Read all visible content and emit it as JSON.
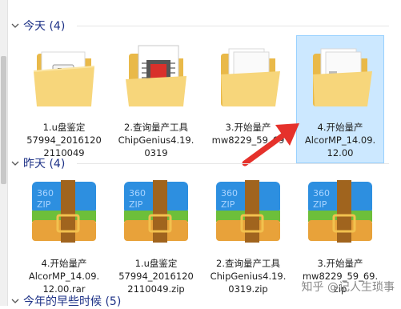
{
  "groups": [
    {
      "title": "今天 (4)"
    },
    {
      "title": "昨天 (4)"
    },
    {
      "title": "今年的早些时候 (5)"
    }
  ],
  "today": [
    {
      "lines": [
        "1.u盘鉴定",
        "57994_2016120",
        "2110049"
      ],
      "icon": "usb-folder-icon"
    },
    {
      "lines": [
        "2.查询量产工具",
        "ChipGenius4.19.",
        "0319"
      ],
      "icon": "chip-folder-icon"
    },
    {
      "lines": [
        "3.开始量产",
        "mw8229_59_69"
      ],
      "icon": "document-folder-icon"
    },
    {
      "lines": [
        "4.开始量产",
        "AlcorMP_14.09.",
        "12.00"
      ],
      "icon": "document-folder-icon",
      "selected": true
    }
  ],
  "yesterday": [
    {
      "lines": [
        "4.开始量产",
        "AlcorMP_14.09.",
        "12.00.rar"
      ],
      "icon": "360zip-icon"
    },
    {
      "lines": [
        "1.u盘鉴定",
        "57994_2016120",
        "2110049.zip"
      ],
      "icon": "360zip-icon"
    },
    {
      "lines": [
        "2.查询量产工具",
        "ChipGenius4.19.",
        "0319.zip"
      ],
      "icon": "360zip-icon"
    },
    {
      "lines": [
        "3.开始量产",
        "mw8229_59_69.",
        "zip"
      ],
      "icon": "360zip-icon"
    }
  ],
  "zip_badge": {
    "top": "360",
    "bottom": "ZIP"
  },
  "watermark": "知乎 @记人生琐事",
  "colors": {
    "header_text": "#1e3287",
    "selection_bg": "#cce8ff",
    "selection_border": "#99d1ff",
    "arrow": "#e5312b",
    "zip_blue": "#2d8fe0",
    "zip_orange": "#e8a23a",
    "zip_strap": "#a0641e",
    "folder": "#f7d67b"
  }
}
